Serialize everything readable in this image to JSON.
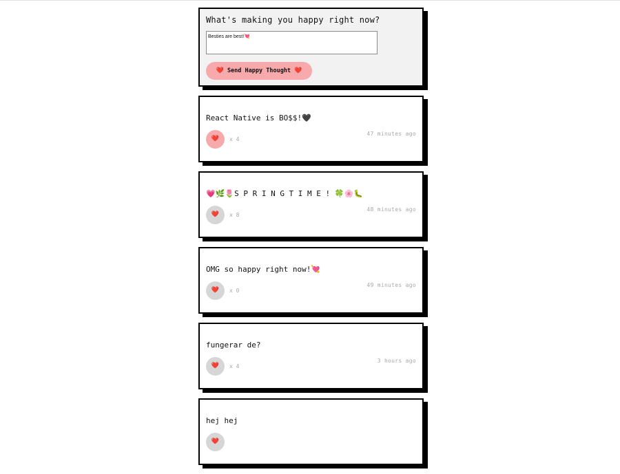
{
  "form": {
    "title": "What's making you happy right now?",
    "input_value": "Besties are best!💘",
    "send_label": "Send Happy Thought",
    "heart": "❤️"
  },
  "thoughts": [
    {
      "message": "React Native is BO$$!🖤",
      "likes": "x 4",
      "time": "47 minutes ago",
      "liked": true
    },
    {
      "message": "💗🌿🌷S P R I N G T I M E ! 🍀🌸🐛",
      "likes": "x 8",
      "time": "48 minutes ago",
      "liked": false
    },
    {
      "message": "OMG so happy right now!💘",
      "likes": "x 0",
      "time": "49 minutes ago",
      "liked": false
    },
    {
      "message": "fungerar de?",
      "likes": "x 4",
      "time": "3 hours ago",
      "liked": false
    },
    {
      "message": "hej hej",
      "likes": "",
      "time": "",
      "liked": false
    }
  ],
  "like_icon": "❤️",
  "colors": {
    "accent_pink": "#f8a9ab",
    "like_inactive": "#d6d6d6",
    "form_bg": "#f2f2f2",
    "muted_text": "#a8a8a8"
  }
}
